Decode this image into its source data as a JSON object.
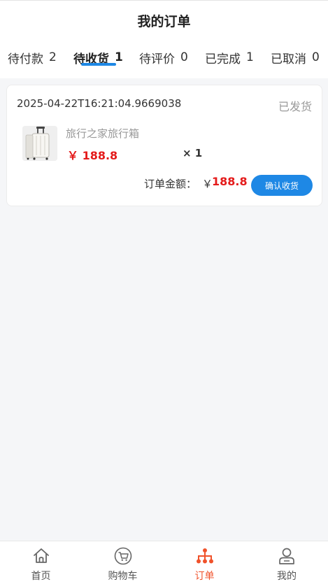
{
  "header": {
    "title": "我的订单"
  },
  "tabs": [
    {
      "label": "待付款",
      "count": "2"
    },
    {
      "label": "待收货",
      "count": "1"
    },
    {
      "label": "待评价",
      "count": "0"
    },
    {
      "label": "已完成",
      "count": "1"
    },
    {
      "label": "已取消",
      "count": "0"
    }
  ],
  "active_tab": "待收货",
  "order": {
    "time": "2025-04-22T16:21:04.9669038",
    "status": "已发货",
    "product": {
      "image": "luggage-image",
      "name": "旅行之家旅行箱",
      "price": "￥ 188.8",
      "quantity": "× 1"
    },
    "total_label": "订单金额：",
    "total_symbol": "￥",
    "total_amount": "188.8",
    "confirm_label": "确认收货"
  },
  "tabbar": {
    "items": [
      {
        "label": "首页",
        "icon": "home-icon"
      },
      {
        "label": "购物车",
        "icon": "cart-icon"
      },
      {
        "label": "订单",
        "icon": "order-icon"
      },
      {
        "label": "我的",
        "icon": "user-icon"
      }
    ],
    "active": "订单"
  },
  "colors": {
    "accent": "#1e88e5",
    "price": "#e41b1b",
    "tabbar_active": "#f0522b"
  }
}
